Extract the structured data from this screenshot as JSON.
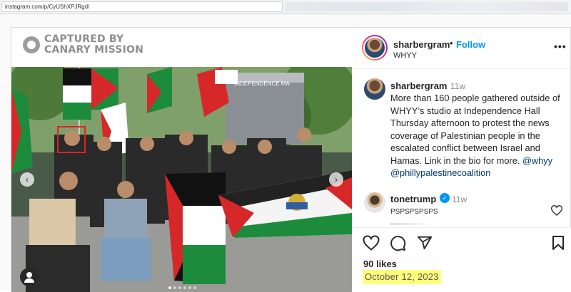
{
  "browser": {
    "url": "instagram.com/p/CyUShXPJRgd/"
  },
  "watermark": {
    "line1": "CAPTURED BY",
    "line2": "CANARY MISSION"
  },
  "photo_overlay": {
    "banner_text": "INDEPENDENCE MA",
    "prev_icon": "chevron-left-icon",
    "next_icon": "chevron-right-icon"
  },
  "header": {
    "username": "sharbergram",
    "separator": "•",
    "follow_label": "Follow",
    "subtitle": "WHYY",
    "more_label": "•••"
  },
  "caption": {
    "username": "sharbergram",
    "time": "11w",
    "text": "More than 160 people gathered outside of WHYY’s studio at Independence Hall Thursday afternoon to protest the news coverage of Palestinian people in the escalated conflict between Israel and Hamas. Link in the bio for more. ",
    "mention1": "@whyy",
    "mention2": "@phillypalestinecoalition"
  },
  "comment": {
    "username": "tonetrump",
    "verified_mark": "✓",
    "time": "11w",
    "text": "PSPSPSPSPS"
  },
  "actions": {
    "likes": "90 likes",
    "date": "October 12, 2023"
  },
  "colors": {
    "follow_blue": "#0095f6",
    "mention_blue": "#00376b",
    "highlight": "#fcff7a",
    "annotation_red": "#e02424"
  }
}
